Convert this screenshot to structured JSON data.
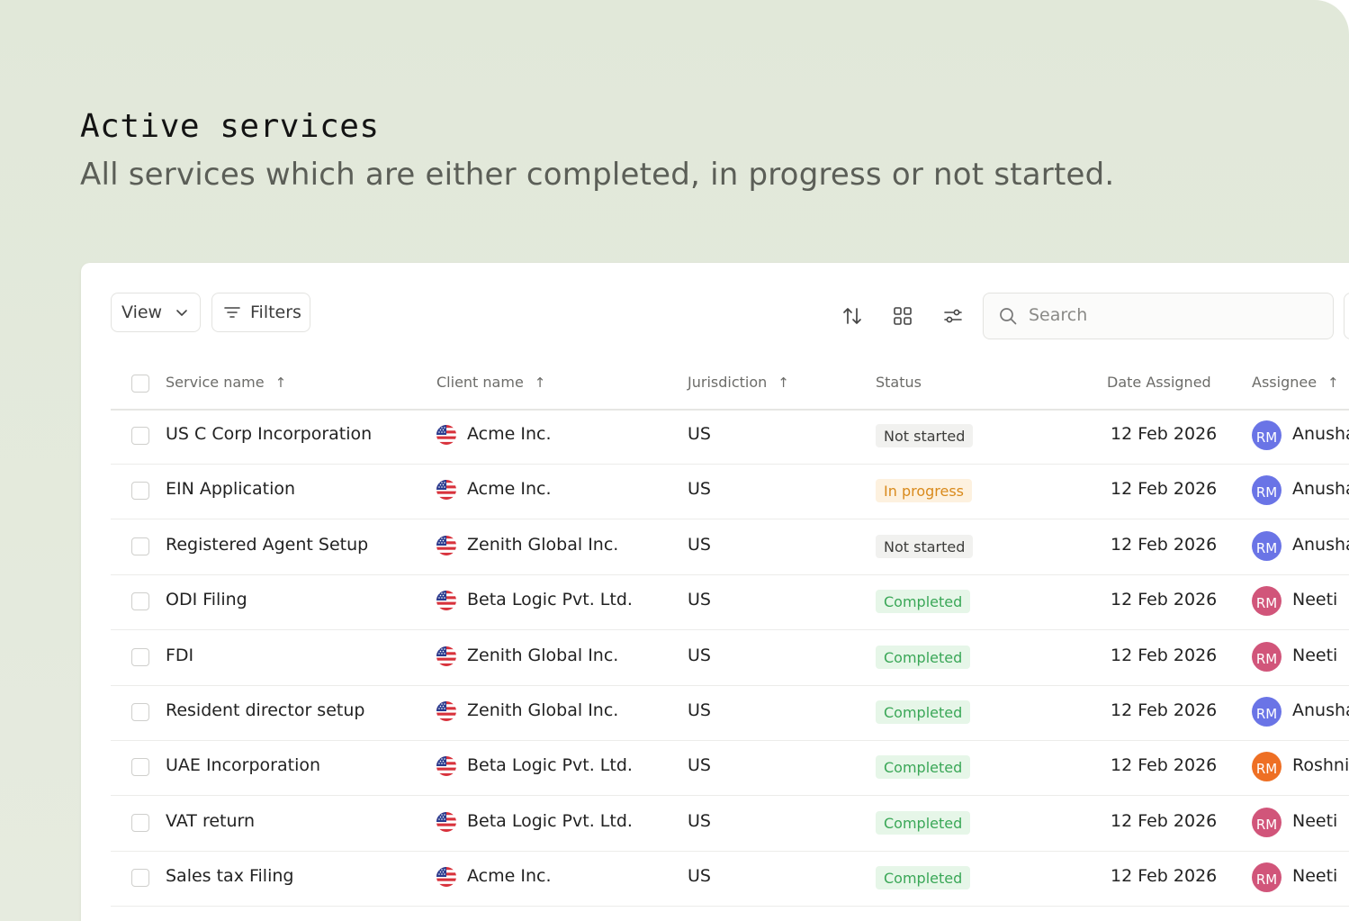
{
  "header": {
    "title": "Active services",
    "subtitle": "All services which are either completed, in progress or not started."
  },
  "toolbar": {
    "view_label": "View",
    "filters_label": "Filters",
    "search_placeholder": "Search"
  },
  "columns": {
    "service": "Service name",
    "client": "Client name",
    "jurisdiction": "Jurisdiction",
    "status": "Status",
    "date": "Date Assigned",
    "assignee": "Assignee",
    "sort_arrow": "↑"
  },
  "status_colors": {
    "Not started": {
      "bg": "#f1f1ef",
      "fg": "#3d3d3b"
    },
    "In progress": {
      "bg": "#fdf1df",
      "fg": "#d98a1c"
    },
    "Completed": {
      "bg": "#e6f6e8",
      "fg": "#3aa757"
    }
  },
  "avatar_colors": {
    "blue": "#6a74e6",
    "pink": "#d1557a",
    "orange": "#ee6f24"
  },
  "rows": [
    {
      "service": "US C Corp Incorporation",
      "client": "Acme Inc.",
      "jurisdiction": "US",
      "status": "Not started",
      "date": "12 Feb 2026",
      "initials": "RM",
      "assignee": "Anusha",
      "avatar_color": "blue"
    },
    {
      "service": "EIN Application",
      "client": "Acme Inc.",
      "jurisdiction": "US",
      "status": "In progress",
      "date": "12 Feb 2026",
      "initials": "RM",
      "assignee": "Anusha",
      "avatar_color": "blue"
    },
    {
      "service": "Registered Agent Setup",
      "client": "Zenith Global Inc.",
      "jurisdiction": "US",
      "status": "Not started",
      "date": "12 Feb 2026",
      "initials": "RM",
      "assignee": "Anusha",
      "avatar_color": "blue"
    },
    {
      "service": "ODI Filing",
      "client": "Beta Logic Pvt. Ltd.",
      "jurisdiction": "US",
      "status": "Completed",
      "date": "12 Feb 2026",
      "initials": "RM",
      "assignee": "Neeti",
      "avatar_color": "pink"
    },
    {
      "service": "FDI",
      "client": "Zenith Global Inc.",
      "jurisdiction": "US",
      "status": "Completed",
      "date": "12 Feb 2026",
      "initials": "RM",
      "assignee": "Neeti",
      "avatar_color": "pink"
    },
    {
      "service": "Resident director setup",
      "client": "Zenith Global Inc.",
      "jurisdiction": "US",
      "status": "Completed",
      "date": "12 Feb 2026",
      "initials": "RM",
      "assignee": "Anusha",
      "avatar_color": "blue"
    },
    {
      "service": "UAE Incorporation",
      "client": "Beta Logic Pvt. Ltd.",
      "jurisdiction": "US",
      "status": "Completed",
      "date": "12 Feb 2026",
      "initials": "RM",
      "assignee": "Roshni",
      "avatar_color": "orange"
    },
    {
      "service": "VAT return",
      "client": "Beta Logic Pvt. Ltd.",
      "jurisdiction": "US",
      "status": "Completed",
      "date": "12 Feb 2026",
      "initials": "RM",
      "assignee": "Neeti",
      "avatar_color": "pink"
    },
    {
      "service": "Sales tax Filing",
      "client": "Acme Inc.",
      "jurisdiction": "US",
      "status": "Completed",
      "date": "12 Feb 2026",
      "initials": "RM",
      "assignee": "Neeti",
      "avatar_color": "pink"
    }
  ]
}
